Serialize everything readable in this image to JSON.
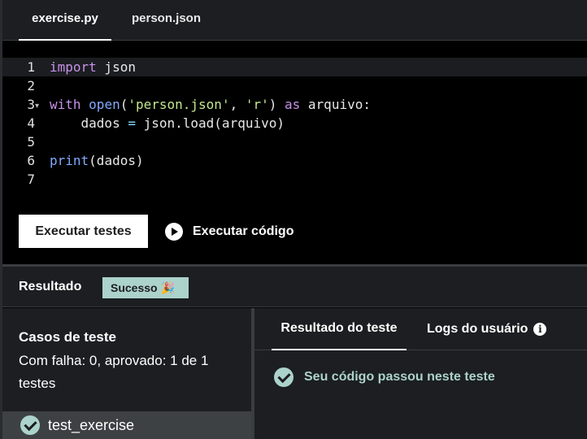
{
  "tabs": [
    {
      "label": "exercise.py",
      "active": true
    },
    {
      "label": "person.json",
      "active": false
    }
  ],
  "editor": {
    "line_numbers": [
      "1",
      "2",
      "3",
      "4",
      "5",
      "6",
      "7"
    ],
    "fold_marker": "▾",
    "code": {
      "line1_kw": "import",
      "line1_rest": " json",
      "line3_kw": "with",
      "line3_fn": "open",
      "line3_p1": "(",
      "line3_str1": "'person.json'",
      "line3_comma": ", ",
      "line3_str2": "'r'",
      "line3_p2": ") ",
      "line3_as": "as",
      "line3_rest": " arquivo:",
      "line4_a": "    dados ",
      "line4_eq": "=",
      "line4_b": " json.load(arquivo)",
      "line6_fn": "print",
      "line6_rest": "(dados)"
    }
  },
  "actions": {
    "run_tests_label": "Executar testes",
    "run_code_label": "Executar código"
  },
  "result": {
    "title": "Resultado",
    "status_badge": "Sucesso 🎉",
    "status_color": "#acd2cc"
  },
  "test_cases": {
    "title": "Casos de teste",
    "summary": "Com falha: 0, aprovado: 1 de 1 testes",
    "items": [
      {
        "name": "test_exercise",
        "status": "passed"
      }
    ]
  },
  "result_tabs": [
    {
      "label": "Resultado do teste",
      "active": true
    },
    {
      "label": "Logs do usuário",
      "active": false
    }
  ],
  "pass_message": "Seu código passou neste teste",
  "icons": {
    "play": "play-icon",
    "check": "check-circle-icon",
    "info": "info-icon"
  }
}
